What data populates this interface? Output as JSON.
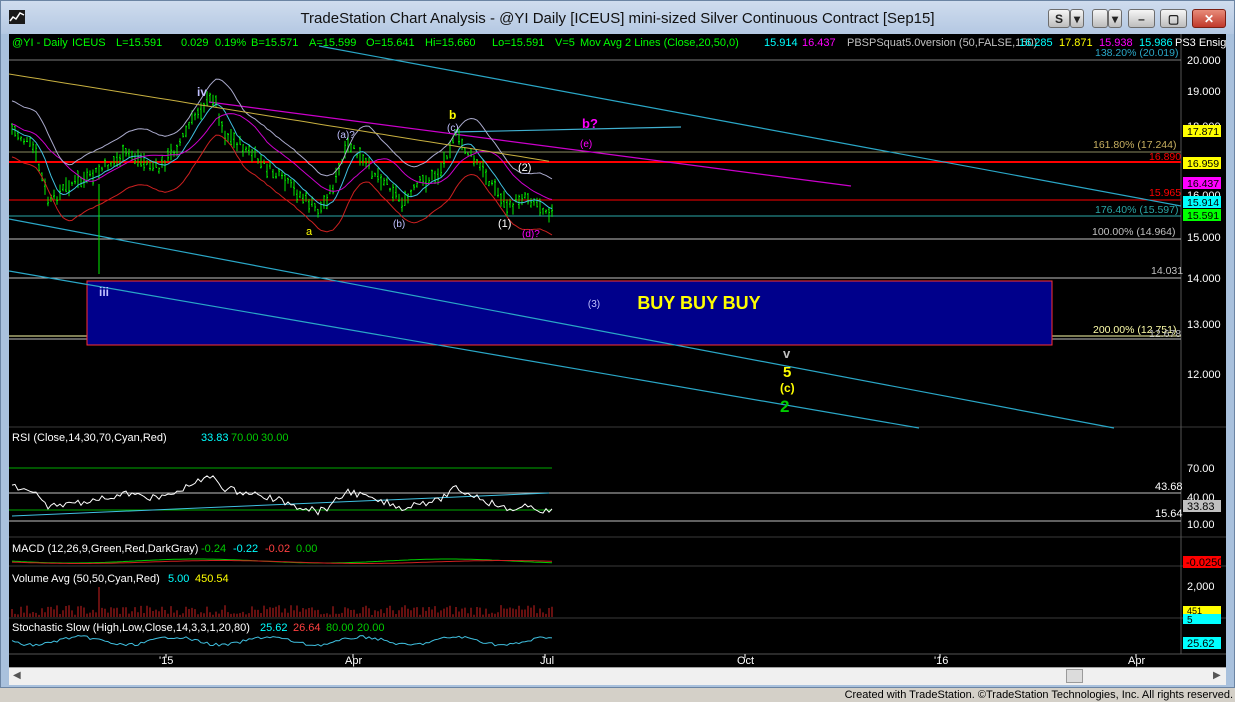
{
  "window": {
    "title": "TradeStation Chart Analysis - @YI Daily [ICEUS] mini-sized Silver Continuous Contract [Sep15]",
    "btn_s": "S",
    "btn_dd": "▾",
    "btn_min": "–",
    "btn_max": "▢",
    "btn_close": "✕"
  },
  "colors": {
    "cyan": "#00ffff",
    "red": "#ff0000",
    "magenta": "#ff00ff",
    "yellow": "#ffff00",
    "green": "#00cc00",
    "gray": "#c0c0c0"
  },
  "price_header": {
    "symbol": "@YI - Daily",
    "exchange": "ICEUS",
    "last": "L=15.591",
    "chg": "0.029",
    "pct": "0.19%",
    "bid": "B=15.571",
    "ask": "A=15.599",
    "open": "O=15.641",
    "hi": "Hi=15.660",
    "lo": "Lo=15.591",
    "vol": "V=5",
    "ma_label": "Mov Avg 2 Lines (Close,20,50,0)",
    "ma1": "15.914",
    "ma2": "16.437",
    "pbs_label": "PBSPSquat5.0version (50,FALSE,150)",
    "pbs1": "16.285",
    "pbs2": "17.871",
    "pbs3": "15.938",
    "pbs4": "15.986",
    "ps3": "PS3 Ensign"
  },
  "price_axis": {
    "ticks": [
      "20.000",
      "19.000",
      "18.000",
      "17.000",
      "16.000",
      "15.000",
      "14.000",
      "13.000",
      "12.000"
    ],
    "right_boxes": [
      {
        "label": "17.871",
        "bg": "#ffff00",
        "fg": "#000000"
      },
      {
        "label": "16.959",
        "bg": "#ffff00",
        "fg": "#000000"
      },
      {
        "label": "16.437",
        "bg": "#ff00ff",
        "fg": "#000000"
      },
      {
        "label": "15.914",
        "bg": "#00ffff",
        "fg": "#000000"
      },
      {
        "label": "15.591",
        "bg": "#00ff00",
        "fg": "#000000"
      }
    ]
  },
  "fib_labels": {
    "f138": "138.20% (20.019)",
    "f161": "161.80% (17.244)",
    "f176": "176.40% (15.597)",
    "f100": "100.00% (14.964)",
    "f200": "200.00% (12.751)",
    "lvl16890": "16.890",
    "lvl15965": "15.965",
    "lvl14031": "14.031",
    "lvl12678": "12.678"
  },
  "wave_labels": {
    "iv": "iv",
    "iii": "iii",
    "b_top": "b",
    "c_paren": "(c)",
    "a_paren": "(a)?",
    "a_low": "a",
    "b_paren": "(b)",
    "one": "(1)",
    "two": "(2)",
    "d_q": "(d)?",
    "e_paren": "(e)",
    "b_q": "b?",
    "three": "(3)",
    "v": "v",
    "five": "5",
    "c_paren2": "(c)",
    "two_green": "2"
  },
  "buy_text": "BUY BUY BUY",
  "rsi": {
    "label": "RSI (Close,14,30,70,Cyan,Red)",
    "v1": "33.83",
    "v2": "70.00",
    "v3": "30.00",
    "ticks": [
      "70.00",
      "40.00",
      "10.00"
    ],
    "box": "33.83",
    "lvl_hi": "43.68",
    "lvl_lo": "15.64"
  },
  "macd": {
    "label": "MACD (12,26,9,Green,Red,DarkGray)",
    "v1": "-0.24",
    "v2": "-0.22",
    "v3": "-0.02",
    "v4": "0.00",
    "box": "-0.0250"
  },
  "volume": {
    "label": "Volume Avg (50,50,Cyan,Red)",
    "v1": "5.00",
    "v2": "450.54",
    "tick": "2,000",
    "box1": "451",
    "box2": "5"
  },
  "stoch": {
    "label": "Stochastic Slow (High,Low,Close,14,3,3,1,20,80)",
    "v1": "25.62",
    "v2": "26.64",
    "v3": "80.00",
    "v4": "20.00",
    "box": "25.62"
  },
  "x_axis": {
    "labels": [
      "'15",
      "Apr",
      "Jul",
      "Oct",
      "'16",
      "Apr"
    ]
  },
  "footer": "Created with TradeStation. ©TradeStation Technologies, Inc. All rights reserved."
}
